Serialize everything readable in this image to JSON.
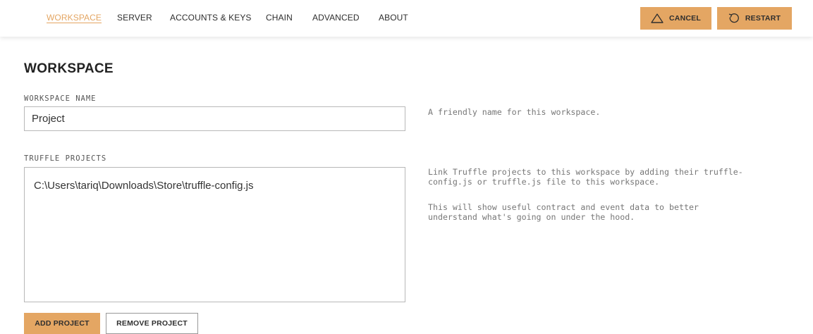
{
  "nav": {
    "tabs": [
      {
        "label": "WORKSPACE",
        "active": true
      },
      {
        "label": "SERVER",
        "active": false
      },
      {
        "label": "ACCOUNTS & KEYS",
        "active": false
      },
      {
        "label": "CHAIN",
        "active": false
      },
      {
        "label": "ADVANCED",
        "active": false
      },
      {
        "label": "ABOUT",
        "active": false
      }
    ],
    "cancel_label": "CANCEL",
    "cancel_icon": "warning-triangle-icon",
    "restart_label": "RESTART",
    "restart_icon": "restart-icon"
  },
  "page": {
    "title": "WORKSPACE"
  },
  "workspace_name": {
    "label": "WORKSPACE NAME",
    "value": "Project",
    "help": "A friendly name for this workspace."
  },
  "truffle_projects": {
    "label": "TRUFFLE PROJECTS",
    "items": [
      "C:\\Users\\tariq\\Downloads\\Store\\truffle-config.js"
    ],
    "help_line1": "Link Truffle projects to this workspace by adding their truffle-\nconfig.js or truffle.js file to this workspace.",
    "help_line2": "This will show useful contract and event data to better\nunderstand what's going on under the hood.",
    "add_label": "ADD PROJECT",
    "remove_label": "REMOVE PROJECT"
  },
  "colors": {
    "accent": "#e4a663",
    "text": "#222222",
    "muted": "#777777"
  }
}
